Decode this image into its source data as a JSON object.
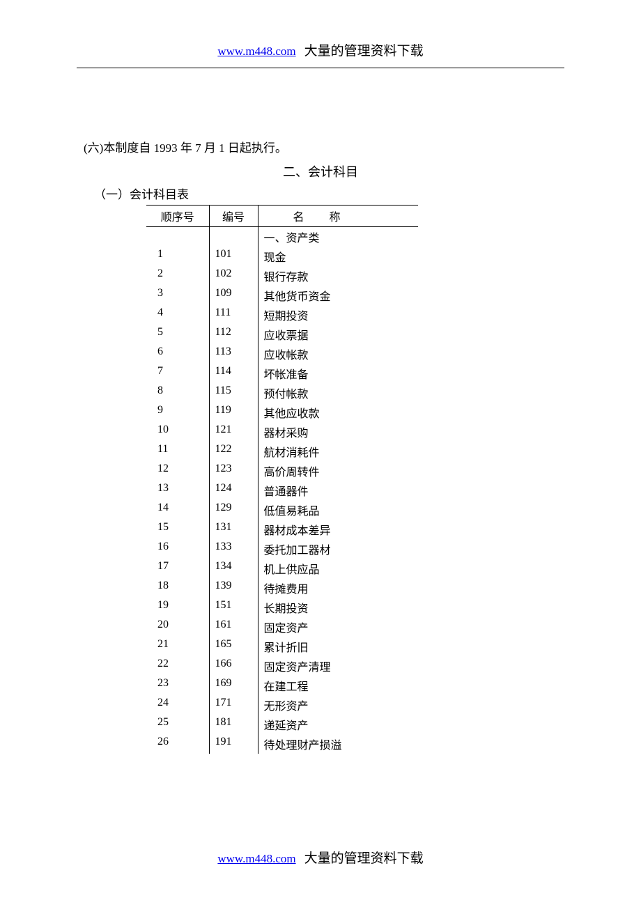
{
  "header": {
    "link": "www.m448.com",
    "text": "大量的管理资料下载"
  },
  "footer": {
    "link": "www.m448.com",
    "text": "大量的管理资料下载"
  },
  "body_text": {
    "line1": "(六)本制度自 1993 年 7 月 1 日起执行。",
    "section_title": "二、会计科目",
    "subsection": "（一）会计科目表"
  },
  "table": {
    "headers": {
      "seq": "顺序号",
      "code": "编号",
      "name": "名称"
    },
    "category_row": {
      "seq": "",
      "code": "",
      "name": "一、资产类"
    },
    "rows": [
      {
        "seq": "1",
        "code": "101",
        "name": "现金"
      },
      {
        "seq": "2",
        "code": "102",
        "name": "银行存款"
      },
      {
        "seq": "3",
        "code": "109",
        "name": "其他货币资金"
      },
      {
        "seq": "4",
        "code": "111",
        "name": "短期投资"
      },
      {
        "seq": "5",
        "code": "112",
        "name": "应收票据"
      },
      {
        "seq": "6",
        "code": "113",
        "name": "应收帐款"
      },
      {
        "seq": "7",
        "code": "114",
        "name": "坏帐准备"
      },
      {
        "seq": "8",
        "code": "115",
        "name": "预付帐款"
      },
      {
        "seq": "9",
        "code": "119",
        "name": "其他应收款"
      },
      {
        "seq": "10",
        "code": "121",
        "name": "器材采购"
      },
      {
        "seq": "11",
        "code": "122",
        "name": "航材消耗件"
      },
      {
        "seq": "12",
        "code": "123",
        "name": "高价周转件"
      },
      {
        "seq": "13",
        "code": "124",
        "name": "普通器件"
      },
      {
        "seq": "14",
        "code": "129",
        "name": "低值易耗品"
      },
      {
        "seq": "15",
        "code": "131",
        "name": "器材成本差异"
      },
      {
        "seq": "16",
        "code": "133",
        "name": "委托加工器材"
      },
      {
        "seq": "17",
        "code": "134",
        "name": "机上供应品"
      },
      {
        "seq": "18",
        "code": "139",
        "name": "待摊费用"
      },
      {
        "seq": "19",
        "code": "151",
        "name": "长期投资"
      },
      {
        "seq": "20",
        "code": "161",
        "name": "固定资产"
      },
      {
        "seq": "21",
        "code": "165",
        "name": "累计折旧"
      },
      {
        "seq": "22",
        "code": "166",
        "name": "固定资产清理"
      },
      {
        "seq": "23",
        "code": "169",
        "name": "在建工程"
      },
      {
        "seq": "24",
        "code": "171",
        "name": "无形资产"
      },
      {
        "seq": "25",
        "code": "181",
        "name": "递延资产"
      },
      {
        "seq": "26",
        "code": "191",
        "name": "待处理财产损溢"
      }
    ]
  }
}
